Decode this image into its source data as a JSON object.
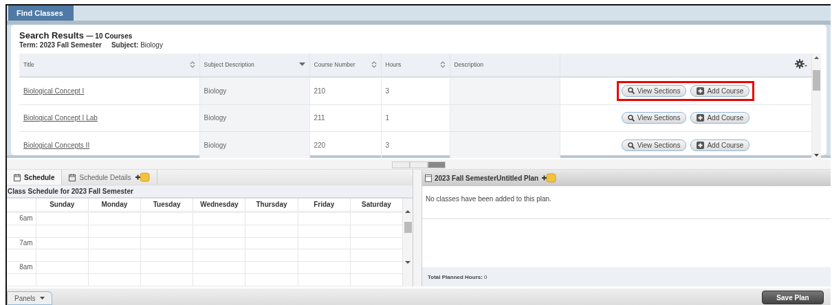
{
  "tab": {
    "label": "Find Classes",
    "selected": true
  },
  "results": {
    "heading": "Search Results",
    "count": "— 10 Courses",
    "term_label": "Term:",
    "term": "2023 Fall Semester",
    "subject_label": "Subject:",
    "subject": "Biology",
    "columns": [
      {
        "label": "Title",
        "kind": "sortable"
      },
      {
        "label": "Subject Description",
        "kind": "sorted"
      },
      {
        "label": "Course Number",
        "kind": "sortable"
      },
      {
        "label": "Hours",
        "kind": "sortable"
      },
      {
        "label": "Description",
        "kind": "plain"
      }
    ],
    "rows": [
      {
        "title": "Biological Concept I",
        "subject": "Biology",
        "number": "210",
        "hours": "3",
        "highlighted": true,
        "actions": [
          "View Sections",
          "Add Course"
        ]
      },
      {
        "title": "Biological Concept I Lab",
        "subject": "Biology",
        "number": "211",
        "hours": "1",
        "highlighted": false,
        "actions": [
          "View Sections",
          "Add Course"
        ]
      },
      {
        "title": "Biological Concepts II",
        "subject": "Biology",
        "number": "220",
        "hours": "3",
        "highlighted": false,
        "actions": [
          "View Sections",
          "Add Course"
        ]
      }
    ]
  },
  "schedule": {
    "tabs": [
      {
        "label": "Schedule",
        "selected": true
      },
      {
        "label": "Schedule Details",
        "selected": false
      }
    ],
    "caption": "Class Schedule for 2023 Fall Semester",
    "days": [
      "Sunday",
      "Monday",
      "Tuesday",
      "Wednesday",
      "Thursday",
      "Friday",
      "Saturday"
    ],
    "times": [
      "6am",
      "7am",
      "8am"
    ]
  },
  "plan": {
    "title": "2023 Fall SemesterUntitled Plan",
    "message": "No classes have been added to this plan.",
    "total_label": "Total Planned Hours:",
    "total": "0"
  },
  "footer": {
    "panels": "Panels",
    "save": "Save Plan"
  }
}
